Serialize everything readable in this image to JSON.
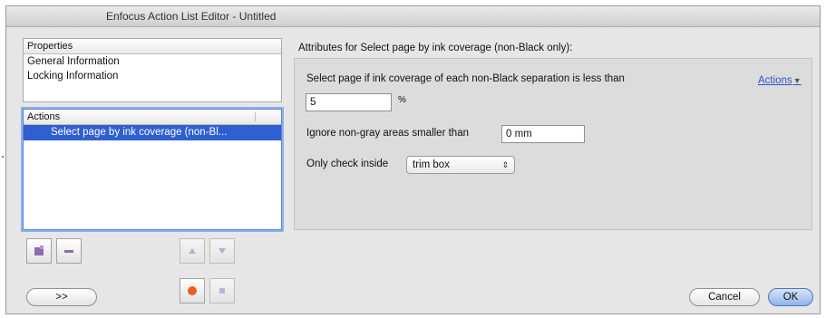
{
  "window": {
    "title": "Enfocus Action List Editor - Untitled"
  },
  "properties": {
    "header": "Properties",
    "items": [
      "General Information",
      "Locking Information"
    ]
  },
  "actions_list": {
    "header": "Actions",
    "items": [
      "Select page by ink coverage (non-Bl..."
    ]
  },
  "attributes": {
    "heading": "Attributes for Select page by ink coverage (non-Black only):",
    "coverage_label": "Select page if ink coverage of each non-Black separation is less than",
    "coverage_value": "5",
    "coverage_unit": "%",
    "ignore_label": "Ignore non-gray areas smaller than",
    "ignore_value": "0 mm",
    "check_label": "Only check inside",
    "check_value": "trim box",
    "actions_menu": "Actions"
  },
  "buttons": {
    "expand": ">>",
    "cancel": "Cancel",
    "ok": "OK"
  },
  "icons": {
    "add": "add-action-icon",
    "remove": "remove-action-icon",
    "up": "move-up-icon",
    "down": "move-down-icon",
    "record": "record-icon",
    "stop": "stop-icon"
  },
  "colors": {
    "selection": "#2f5fd0",
    "link": "#2c55c9",
    "record": "#e8601c",
    "default_button": "#8fb3ea"
  }
}
